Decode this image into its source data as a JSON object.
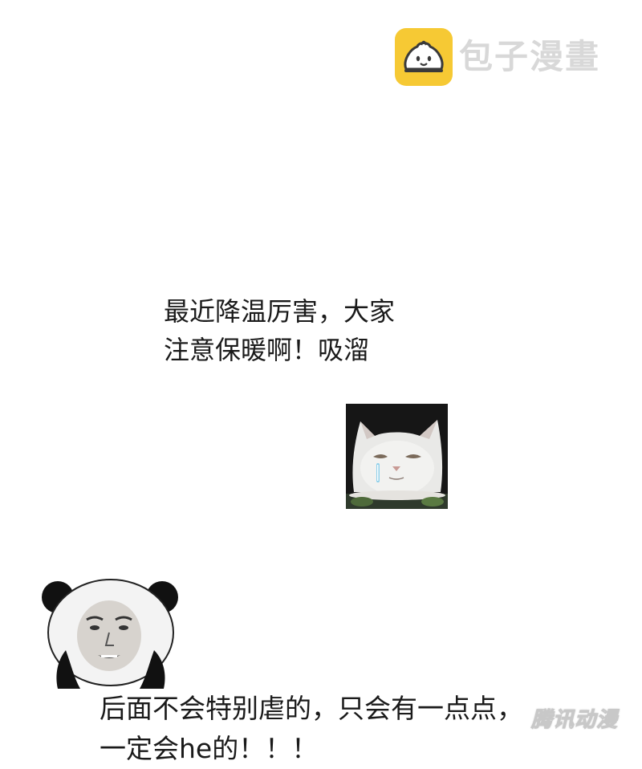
{
  "watermark": {
    "logo_text": "包子漫畫",
    "logo_icon": "bun-face-icon",
    "logo_color": "#f6c934",
    "bottom_text": "腾讯动漫"
  },
  "note": {
    "lines": [
      "最近降温厉害，大家",
      "注意保暖啊！吸溜"
    ]
  },
  "stickers": {
    "cat": "cat-meme-sticker",
    "panda": "panda-meme-sticker"
  },
  "bottom_note": {
    "lines": [
      "后面不会特别虐的，只会有一点点，",
      "一定会he的！！！"
    ]
  }
}
